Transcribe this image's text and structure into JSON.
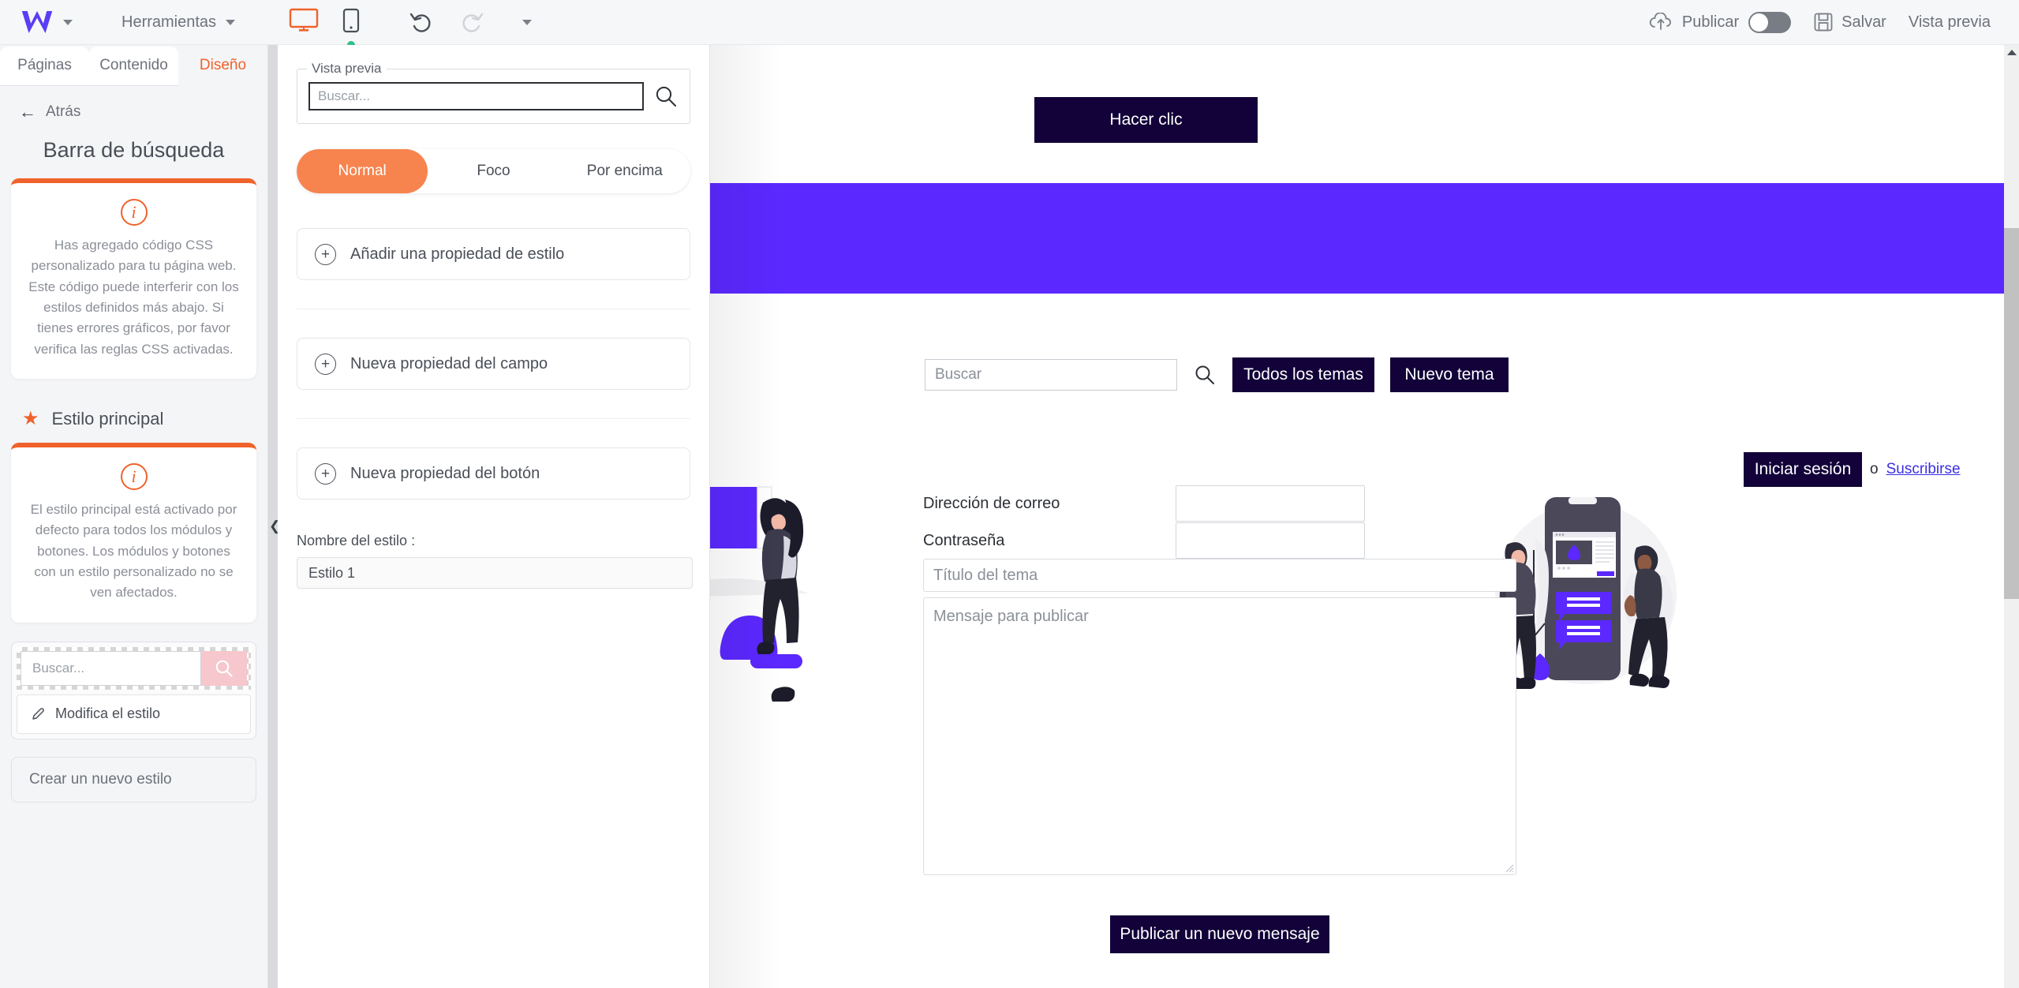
{
  "topbar": {
    "logo_icon": "webself-w-logo",
    "logo_caret_icon": "chevron-down-icon",
    "tools_label": "Herramientas",
    "tools_caret_icon": "chevron-down-icon",
    "desktop_icon": "desktop-monitor-icon",
    "mobile_icon": "mobile-phone-icon",
    "undo_icon": "undo-arrow-icon",
    "redo_icon": "redo-arrow-icon",
    "more_caret_icon": "chevron-down-icon",
    "publish_icon": "cloud-upload-icon",
    "publish_label": "Publicar",
    "publish_toggle_state": "off",
    "save_icon": "floppy-disk-icon",
    "save_label": "Salvar",
    "preview_label": "Vista previa"
  },
  "sidebar": {
    "tabs": [
      {
        "label": "Páginas",
        "active": false
      },
      {
        "label": "Contenido",
        "active": false
      },
      {
        "label": "Diseño",
        "active": true
      }
    ],
    "back_icon": "arrow-left-icon",
    "back_label": "Atrás",
    "panel_title": "Barra de búsqueda",
    "css_warning": {
      "icon": "info-circle-icon",
      "text": "Has agregado código CSS personalizado para tu página web. Este código puede interferir con los estilos definidos más abajo. Si tienes errores gráficos, por favor verifica las reglas CSS activadas."
    },
    "main_style": {
      "star_icon": "star-icon",
      "heading": "Estilo principal",
      "icon": "info-circle-icon",
      "text": "El estilo principal está activado por defecto para todos los módulos y botones. Los módulos y botones con un estilo personalizado no se ven afectados."
    },
    "style_preview": {
      "search_placeholder": "Buscar...",
      "search_icon": "search-magnifier-icon",
      "search_button_color": "#f6c7cd",
      "modify_icon": "pencil-edit-icon",
      "modify_label": "Modifica el estilo"
    },
    "create_style_label": "Crear un nuevo estilo",
    "collapse_icon": "chevron-left-icon"
  },
  "properties_panel": {
    "preview": {
      "legend": "Vista previa",
      "input_placeholder": "Buscar...",
      "search_icon": "search-magnifier-icon"
    },
    "state_tabs": [
      {
        "label": "Normal",
        "active": true
      },
      {
        "label": "Foco",
        "active": false
      },
      {
        "label": "Por encima",
        "active": false
      }
    ],
    "add_rows": [
      {
        "icon": "plus-circle-icon",
        "label": "Añadir una propiedad de estilo"
      },
      {
        "icon": "plus-circle-icon",
        "label": "Nueva propiedad del campo"
      },
      {
        "icon": "plus-circle-icon",
        "label": "Nueva propiedad del botón"
      }
    ],
    "style_name_label": "Nombre del estilo :",
    "style_name_value": "Estilo 1"
  },
  "canvas": {
    "click_button_label": "Hacer clic",
    "banner_color": "#5b28ff",
    "dark_button_color": "#120239",
    "search_placeholder": "Buscar",
    "search_icon": "search-magnifier-icon",
    "all_topics_label": "Todos los temas",
    "new_topic_label": "Nuevo tema",
    "login_button_label": "Iniciar sesión",
    "or_label": "o",
    "subscribe_link_label": "Suscribirse",
    "email_label": "Dirección de correo",
    "email_value": "",
    "password_label": "Contraseña",
    "password_value": "",
    "topic_title_placeholder": "Título del tema",
    "message_placeholder": "Mensaje para publicar",
    "publish_message_label": "Publicar un nuevo mensaje",
    "illustration_left": "woman-standing-illustration",
    "illustration_right": "two-people-mobile-app-illustration"
  },
  "scrollbar": {
    "up_arrow_icon": "triangle-up-icon"
  }
}
